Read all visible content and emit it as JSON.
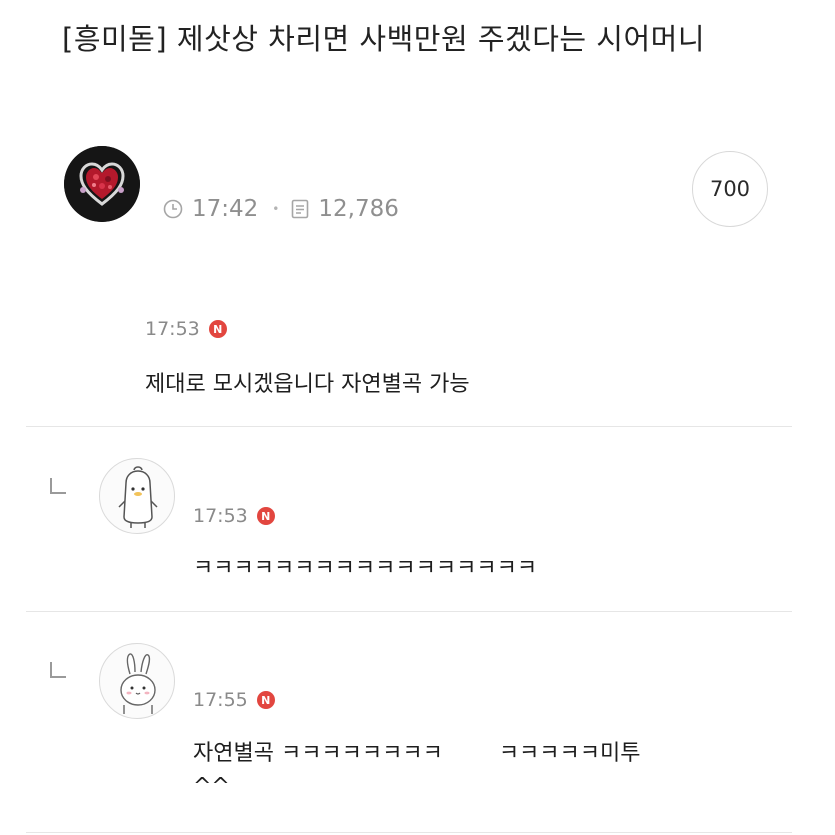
{
  "post": {
    "title": "[흥미돋] 제삿상 차리면 사백만원 주겠다는 시어머니",
    "time": "17:42",
    "views": "12,786",
    "comment_count": "700"
  },
  "comments": [
    {
      "time": "17:53",
      "badge": "N",
      "text": "제대로 모시겠읍니다 자연별곡 가능"
    },
    {
      "time": "17:53",
      "badge": "N",
      "text": "ㅋㅋㅋㅋㅋㅋㅋㅋㅋㅋㅋㅋㅋㅋㅋㅋㅋ"
    },
    {
      "time": "17:55",
      "badge": "N",
      "text": "자연별곡 ㅋㅋㅋㅋㅋㅋㅋㅋ        ㅋㅋㅋㅋㅋ미투",
      "text_line2": "^^"
    }
  ],
  "icons": {
    "clock": "clock-icon",
    "views": "document-icon",
    "reply": "reply-arrow-icon"
  },
  "colors": {
    "new_badge": "#e2463f",
    "meta_text": "#8f8f8f"
  }
}
